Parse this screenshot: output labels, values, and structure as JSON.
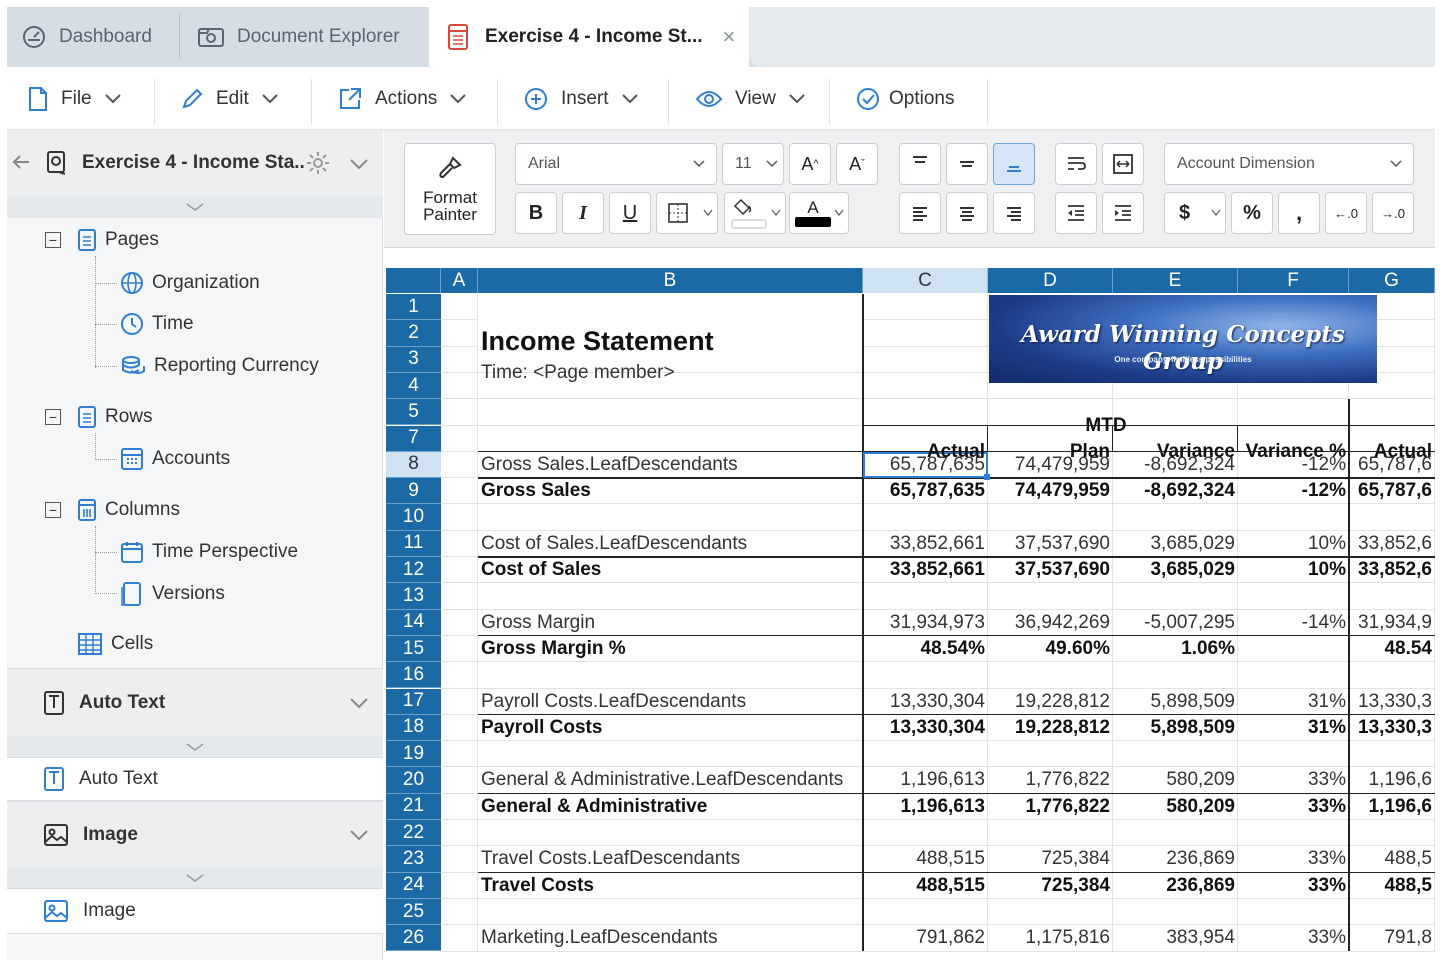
{
  "tabs": {
    "dashboard": "Dashboard",
    "document_explorer": "Document Explorer",
    "active": "Exercise 4 - Income St...",
    "close": "×"
  },
  "menu": {
    "file": "File",
    "edit": "Edit",
    "actions": "Actions",
    "insert": "Insert",
    "view": "View",
    "options": "Options"
  },
  "panel": {
    "title": "Exercise 4 - Income Sta..",
    "pages": "Pages",
    "organization": "Organization",
    "time": "Time",
    "reporting_currency": "Reporting Currency",
    "rows": "Rows",
    "accounts": "Accounts",
    "columns": "Columns",
    "time_perspective": "Time Perspective",
    "versions": "Versions",
    "cells": "Cells",
    "auto_text_section": "Auto Text",
    "auto_text_item": "Auto Text",
    "image_section": "Image",
    "image_item": "Image"
  },
  "ribbon": {
    "format_painter_1": "Format",
    "format_painter_2": "Painter",
    "font": "Arial",
    "size": "11",
    "grow": "A",
    "shrink": "A",
    "bold": "B",
    "italic": "I",
    "underline": "U",
    "font_color": "A",
    "dimension": "Account Dimension",
    "currency": "$",
    "percent": "%",
    "comma": ",",
    "dec_decrease": "←.0",
    "dec_increase": "→.0"
  },
  "grid": {
    "columns": [
      "A",
      "B",
      "C",
      "D",
      "E",
      "F",
      "G"
    ],
    "rows": [
      "1",
      "2",
      "3",
      "4",
      "5",
      "7",
      "8",
      "9",
      "10",
      "11",
      "12",
      "13",
      "14",
      "15",
      "16",
      "17",
      "18",
      "19",
      "20",
      "21",
      "22",
      "23",
      "24",
      "25",
      "26"
    ],
    "title": "Income Statement",
    "subtitle": "Time: <Page member>",
    "logo": "Award Winning Concepts Group",
    "logo_tagline": "One company, limitless possibilities",
    "mtd": "MTD",
    "headers": [
      "Actual",
      "Plan",
      "Variance",
      "Variance %",
      "Actual"
    ],
    "data_rows": [
      {
        "label": "Gross Sales.LeafDescendants",
        "bold": false,
        "c": "65,787,635",
        "d": "74,479,959",
        "e": "-8,692,324",
        "f": "-12%",
        "g": "65,787,6"
      },
      {
        "label": "Gross Sales",
        "bold": true,
        "c": "65,787,635",
        "d": "74,479,959",
        "e": "-8,692,324",
        "f": "-12%",
        "g": "65,787,6"
      },
      {
        "label": "",
        "bold": false,
        "c": "",
        "d": "",
        "e": "",
        "f": "",
        "g": ""
      },
      {
        "label": "Cost of Sales.LeafDescendants",
        "bold": false,
        "c": "33,852,661",
        "d": "37,537,690",
        "e": "3,685,029",
        "f": "10%",
        "g": "33,852,6"
      },
      {
        "label": "Cost of Sales",
        "bold": true,
        "c": "33,852,661",
        "d": "37,537,690",
        "e": "3,685,029",
        "f": "10%",
        "g": "33,852,6"
      },
      {
        "label": "",
        "bold": false,
        "c": "",
        "d": "",
        "e": "",
        "f": "",
        "g": ""
      },
      {
        "label": "Gross Margin",
        "bold": false,
        "c": "31,934,973",
        "d": "36,942,269",
        "e": "-5,007,295",
        "f": "-14%",
        "g": "31,934,9"
      },
      {
        "label": "Gross Margin %",
        "bold": true,
        "c": "48.54%",
        "d": "49.60%",
        "e": "1.06%",
        "f": "",
        "g": "48.54"
      },
      {
        "label": "",
        "bold": false,
        "c": "",
        "d": "",
        "e": "",
        "f": "",
        "g": ""
      },
      {
        "label": "Payroll Costs.LeafDescendants",
        "bold": false,
        "c": "13,330,304",
        "d": "19,228,812",
        "e": "5,898,509",
        "f": "31%",
        "g": "13,330,3"
      },
      {
        "label": "Payroll Costs",
        "bold": true,
        "c": "13,330,304",
        "d": "19,228,812",
        "e": "5,898,509",
        "f": "31%",
        "g": "13,330,3"
      },
      {
        "label": "",
        "bold": false,
        "c": "",
        "d": "",
        "e": "",
        "f": "",
        "g": ""
      },
      {
        "label": "General & Administrative.LeafDescendants",
        "bold": false,
        "c": "1,196,613",
        "d": "1,776,822",
        "e": "580,209",
        "f": "33%",
        "g": "1,196,6"
      },
      {
        "label": "General & Administrative",
        "bold": true,
        "c": "1,196,613",
        "d": "1,776,822",
        "e": "580,209",
        "f": "33%",
        "g": "1,196,6"
      },
      {
        "label": "",
        "bold": false,
        "c": "",
        "d": "",
        "e": "",
        "f": "",
        "g": ""
      },
      {
        "label": "Travel Costs.LeafDescendants",
        "bold": false,
        "c": "488,515",
        "d": "725,384",
        "e": "236,869",
        "f": "33%",
        "g": "488,5"
      },
      {
        "label": "Travel Costs",
        "bold": true,
        "c": "488,515",
        "d": "725,384",
        "e": "236,869",
        "f": "33%",
        "g": "488,5"
      },
      {
        "label": "",
        "bold": false,
        "c": "",
        "d": "",
        "e": "",
        "f": "",
        "g": ""
      },
      {
        "label": "Marketing.LeafDescendants",
        "bold": false,
        "c": "791,862",
        "d": "1,175,816",
        "e": "383,954",
        "f": "33%",
        "g": "791,8"
      }
    ]
  },
  "colors": {
    "header_blue": "#1b6aa6",
    "selected_header": "#cfe2f3",
    "tab_bg": "#d6dde5",
    "accent": "#2e7fd1",
    "pdf_red": "#d9473a"
  }
}
